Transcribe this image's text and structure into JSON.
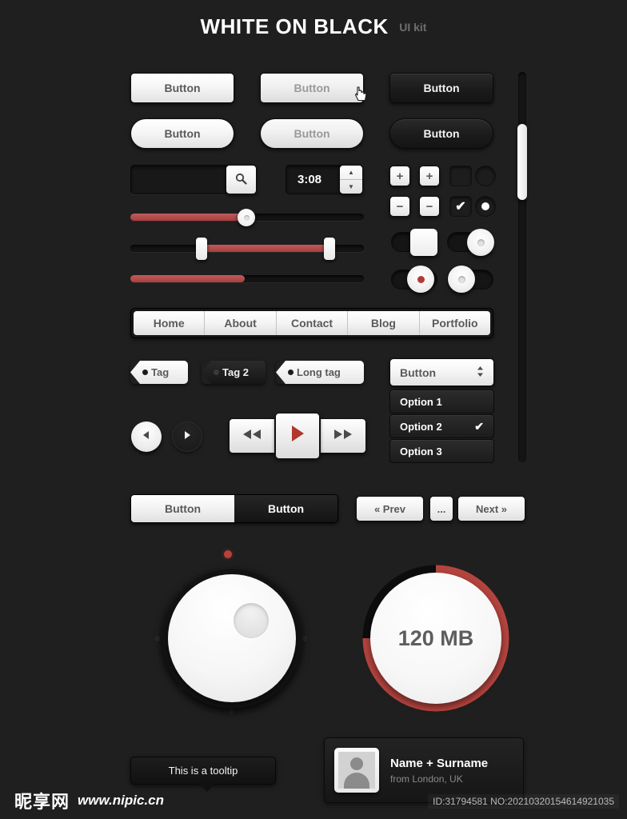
{
  "header": {
    "title": "WHITE ON BLACK",
    "subtitle": "UI kit"
  },
  "buttons": {
    "rect": [
      {
        "label": "Button",
        "state": "normal"
      },
      {
        "label": "Button",
        "state": "hover"
      },
      {
        "label": "Button",
        "state": "dark"
      }
    ],
    "pill": [
      {
        "label": "Button",
        "state": "normal"
      },
      {
        "label": "Button",
        "state": "hover"
      },
      {
        "label": "Button",
        "state": "dark"
      }
    ]
  },
  "search": {
    "value": "",
    "placeholder": "",
    "icon": "search-icon"
  },
  "spinner": {
    "value": "3:08",
    "up_icon": "triangle-up-icon",
    "down_icon": "triangle-down-icon"
  },
  "steppers": {
    "plus_label": "+",
    "minus_label": "−",
    "check_label": "✔",
    "radio_dot": ""
  },
  "sliders": [
    {
      "name": "single-slider",
      "fill_percent": 50
    },
    {
      "name": "range-slider",
      "start_percent": 30,
      "end_percent": 86
    },
    {
      "name": "progress-bar",
      "fill_percent": 49
    }
  ],
  "nav": {
    "items": [
      "Home",
      "About",
      "Contact",
      "Blog",
      "Portfolio"
    ]
  },
  "tags": [
    {
      "label": "Tag",
      "style": "light"
    },
    {
      "label": "Tag 2",
      "style": "dark"
    },
    {
      "label": "Long tag",
      "style": "light"
    }
  ],
  "dropdown": {
    "label": "Button",
    "toggle_icon": "chevron-up-down-icon",
    "options": [
      {
        "label": "Option 1",
        "selected": false
      },
      {
        "label": "Option 2",
        "selected": true
      },
      {
        "label": "Option 3",
        "selected": false
      }
    ],
    "check_glyph": "✔"
  },
  "media": {
    "prev_icon": "◀",
    "next_icon": "▶",
    "rewind_icon": "◀◀",
    "play_icon": "▶",
    "forward_icon": "▶▶"
  },
  "segmented": {
    "left_label": "Button",
    "right_label": "Button"
  },
  "pagination": {
    "prev_label": "« Prev",
    "ellipsis_label": "...",
    "next_label": "Next »"
  },
  "dial": {
    "name": "rotary-knob",
    "led_color": "#b8413d"
  },
  "meter": {
    "value_label": "120 MB",
    "arc_percent": 75,
    "arc_color": "#b5443f"
  },
  "tooltip": {
    "text": "This is a tooltip"
  },
  "profile": {
    "name": "Name + Surname",
    "location": "from London, UK",
    "avatar": "user-avatar-placeholder"
  },
  "scrollbar": {
    "name": "vertical-scrollbar",
    "thumb_position_percent": 13
  },
  "watermark": {
    "logo": "昵享网",
    "url": "www.nipic.cn"
  },
  "footer": {
    "id_text": "ID:31794581 NO:20210320154614921035"
  },
  "colors": {
    "background": "#1f1f1f",
    "accent_red": "#b5443f",
    "light_face": "#f2f2f2",
    "text_dark": "#5a5a5a"
  }
}
